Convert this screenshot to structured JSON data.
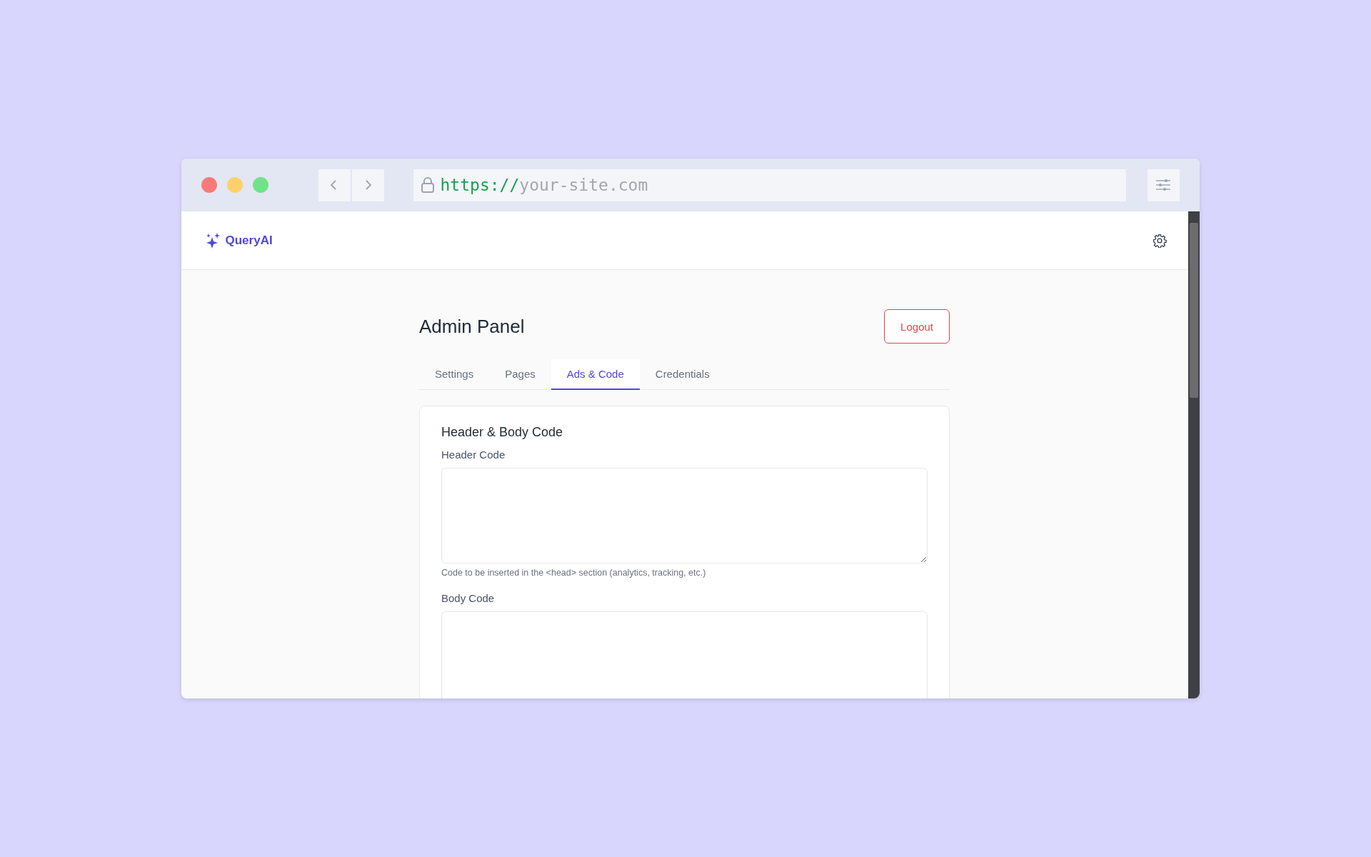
{
  "browser": {
    "url_scheme": "https://",
    "url_host": "your-site.com"
  },
  "app": {
    "brand": "QueryAI"
  },
  "page": {
    "title": "Admin Panel",
    "logout": "Logout"
  },
  "tabs": [
    {
      "label": "Settings",
      "selected": false
    },
    {
      "label": "Pages",
      "selected": false
    },
    {
      "label": "Ads & Code",
      "selected": true
    },
    {
      "label": "Credentials",
      "selected": false
    }
  ],
  "card": {
    "title": "Header & Body Code",
    "fields": [
      {
        "label": "Header Code",
        "hint": "Code to be inserted in the <head> section (analytics, tracking, etc.)"
      },
      {
        "label": "Body Code"
      }
    ]
  }
}
